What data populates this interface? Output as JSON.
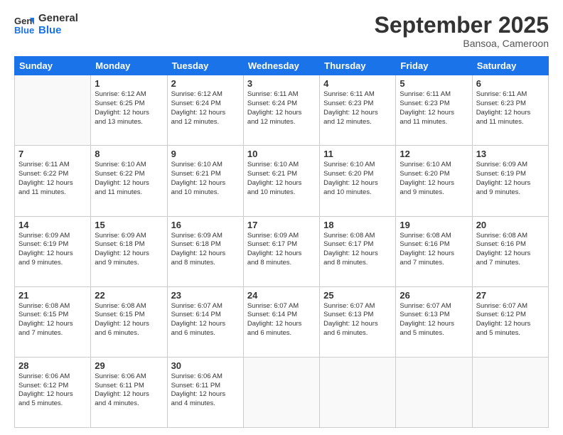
{
  "header": {
    "logo_line1": "General",
    "logo_line2": "Blue",
    "month_title": "September 2025",
    "subtitle": "Bansoa, Cameroon"
  },
  "days_of_week": [
    "Sunday",
    "Monday",
    "Tuesday",
    "Wednesday",
    "Thursday",
    "Friday",
    "Saturday"
  ],
  "weeks": [
    [
      {
        "day": "",
        "text": ""
      },
      {
        "day": "1",
        "text": "Sunrise: 6:12 AM\nSunset: 6:25 PM\nDaylight: 12 hours\nand 13 minutes."
      },
      {
        "day": "2",
        "text": "Sunrise: 6:12 AM\nSunset: 6:24 PM\nDaylight: 12 hours\nand 12 minutes."
      },
      {
        "day": "3",
        "text": "Sunrise: 6:11 AM\nSunset: 6:24 PM\nDaylight: 12 hours\nand 12 minutes."
      },
      {
        "day": "4",
        "text": "Sunrise: 6:11 AM\nSunset: 6:23 PM\nDaylight: 12 hours\nand 12 minutes."
      },
      {
        "day": "5",
        "text": "Sunrise: 6:11 AM\nSunset: 6:23 PM\nDaylight: 12 hours\nand 11 minutes."
      },
      {
        "day": "6",
        "text": "Sunrise: 6:11 AM\nSunset: 6:23 PM\nDaylight: 12 hours\nand 11 minutes."
      }
    ],
    [
      {
        "day": "7",
        "text": "Sunrise: 6:11 AM\nSunset: 6:22 PM\nDaylight: 12 hours\nand 11 minutes."
      },
      {
        "day": "8",
        "text": "Sunrise: 6:10 AM\nSunset: 6:22 PM\nDaylight: 12 hours\nand 11 minutes."
      },
      {
        "day": "9",
        "text": "Sunrise: 6:10 AM\nSunset: 6:21 PM\nDaylight: 12 hours\nand 10 minutes."
      },
      {
        "day": "10",
        "text": "Sunrise: 6:10 AM\nSunset: 6:21 PM\nDaylight: 12 hours\nand 10 minutes."
      },
      {
        "day": "11",
        "text": "Sunrise: 6:10 AM\nSunset: 6:20 PM\nDaylight: 12 hours\nand 10 minutes."
      },
      {
        "day": "12",
        "text": "Sunrise: 6:10 AM\nSunset: 6:20 PM\nDaylight: 12 hours\nand 9 minutes."
      },
      {
        "day": "13",
        "text": "Sunrise: 6:09 AM\nSunset: 6:19 PM\nDaylight: 12 hours\nand 9 minutes."
      }
    ],
    [
      {
        "day": "14",
        "text": "Sunrise: 6:09 AM\nSunset: 6:19 PM\nDaylight: 12 hours\nand 9 minutes."
      },
      {
        "day": "15",
        "text": "Sunrise: 6:09 AM\nSunset: 6:18 PM\nDaylight: 12 hours\nand 9 minutes."
      },
      {
        "day": "16",
        "text": "Sunrise: 6:09 AM\nSunset: 6:18 PM\nDaylight: 12 hours\nand 8 minutes."
      },
      {
        "day": "17",
        "text": "Sunrise: 6:09 AM\nSunset: 6:17 PM\nDaylight: 12 hours\nand 8 minutes."
      },
      {
        "day": "18",
        "text": "Sunrise: 6:08 AM\nSunset: 6:17 PM\nDaylight: 12 hours\nand 8 minutes."
      },
      {
        "day": "19",
        "text": "Sunrise: 6:08 AM\nSunset: 6:16 PM\nDaylight: 12 hours\nand 7 minutes."
      },
      {
        "day": "20",
        "text": "Sunrise: 6:08 AM\nSunset: 6:16 PM\nDaylight: 12 hours\nand 7 minutes."
      }
    ],
    [
      {
        "day": "21",
        "text": "Sunrise: 6:08 AM\nSunset: 6:15 PM\nDaylight: 12 hours\nand 7 minutes."
      },
      {
        "day": "22",
        "text": "Sunrise: 6:08 AM\nSunset: 6:15 PM\nDaylight: 12 hours\nand 6 minutes."
      },
      {
        "day": "23",
        "text": "Sunrise: 6:07 AM\nSunset: 6:14 PM\nDaylight: 12 hours\nand 6 minutes."
      },
      {
        "day": "24",
        "text": "Sunrise: 6:07 AM\nSunset: 6:14 PM\nDaylight: 12 hours\nand 6 minutes."
      },
      {
        "day": "25",
        "text": "Sunrise: 6:07 AM\nSunset: 6:13 PM\nDaylight: 12 hours\nand 6 minutes."
      },
      {
        "day": "26",
        "text": "Sunrise: 6:07 AM\nSunset: 6:13 PM\nDaylight: 12 hours\nand 5 minutes."
      },
      {
        "day": "27",
        "text": "Sunrise: 6:07 AM\nSunset: 6:12 PM\nDaylight: 12 hours\nand 5 minutes."
      }
    ],
    [
      {
        "day": "28",
        "text": "Sunrise: 6:06 AM\nSunset: 6:12 PM\nDaylight: 12 hours\nand 5 minutes."
      },
      {
        "day": "29",
        "text": "Sunrise: 6:06 AM\nSunset: 6:11 PM\nDaylight: 12 hours\nand 4 minutes."
      },
      {
        "day": "30",
        "text": "Sunrise: 6:06 AM\nSunset: 6:11 PM\nDaylight: 12 hours\nand 4 minutes."
      },
      {
        "day": "",
        "text": ""
      },
      {
        "day": "",
        "text": ""
      },
      {
        "day": "",
        "text": ""
      },
      {
        "day": "",
        "text": ""
      }
    ]
  ]
}
